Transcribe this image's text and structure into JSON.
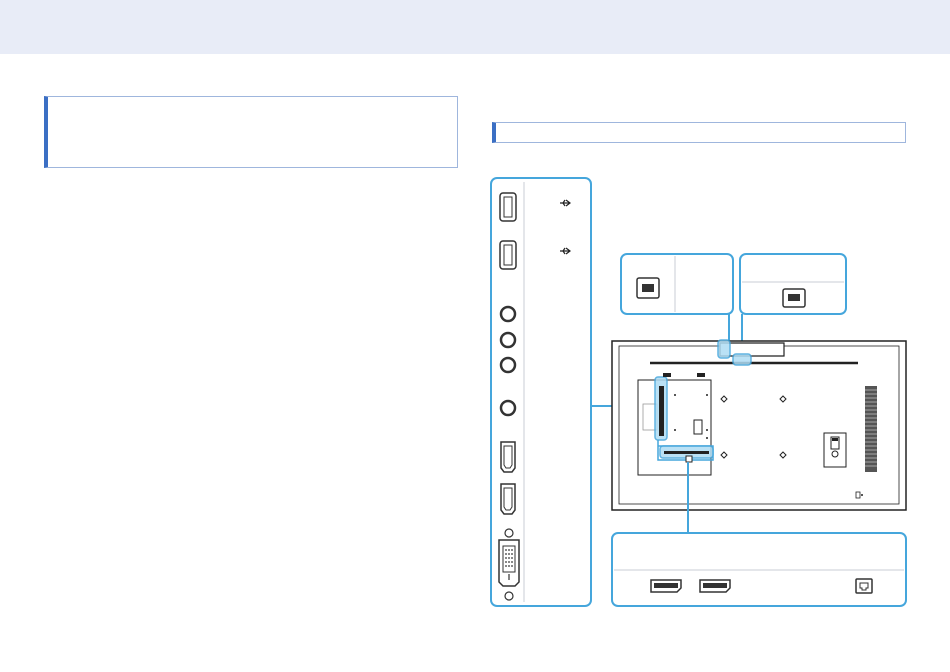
{
  "page": {
    "accent_color": "#3b6fc4",
    "panel_color": "#45a6dc",
    "highlight_color": "#aedcf4",
    "header_color": "#e8ecf7"
  },
  "side_panel": {
    "ports": [
      "usb-a",
      "usb-a",
      "audio",
      "audio",
      "audio",
      "audio",
      "hdmi",
      "hdmi",
      "dvi"
    ],
    "icons": [
      "usb-symbol-icon",
      "usb-symbol-icon"
    ]
  },
  "callouts": {
    "top_left": {
      "ports": [
        "usb-b"
      ]
    },
    "top_right": {
      "ports": [
        "usb-b"
      ]
    },
    "bottom": {
      "ports": [
        "displayport",
        "displayport",
        "ethernet"
      ]
    }
  }
}
